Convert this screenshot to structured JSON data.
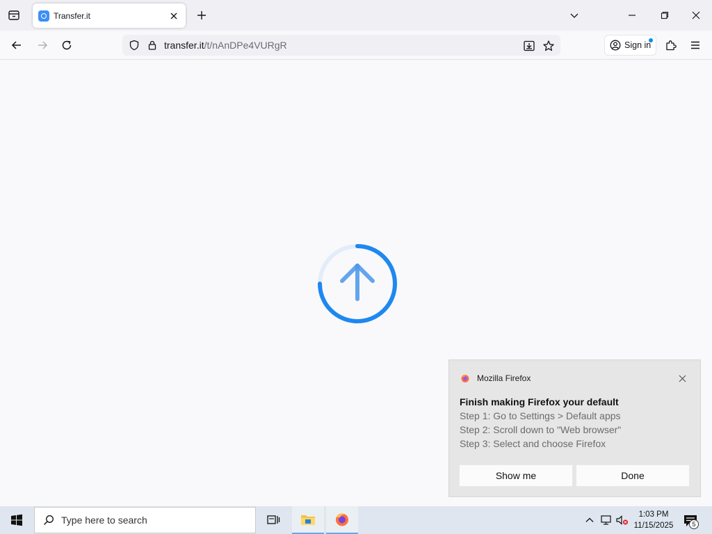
{
  "browser": {
    "tab": {
      "title": "Transfer.it"
    },
    "url": {
      "domain": "transfer.it",
      "path": "/t/nAnDPe4VURgR"
    },
    "signin_label": "Sign in"
  },
  "notification": {
    "app_name": "Mozilla Firefox",
    "title": "Finish making Firefox your default",
    "steps": [
      "Step 1: Go to Settings > Default apps",
      "Step 2: Scroll down to \"Web browser\"",
      "Step 3: Select and choose Firefox"
    ],
    "buttons": {
      "primary": "Show me",
      "secondary": "Done"
    }
  },
  "taskbar": {
    "search_placeholder": "Type here to search",
    "time": "1:03 PM",
    "date": "11/15/2025",
    "notification_count": "5"
  },
  "colors": {
    "spinner_accent": "#1e88f0",
    "spinner_track": "#e3edf9",
    "arrow": "#4a97ea"
  },
  "icons": {
    "tab_list": "tab-list-icon",
    "favicon": "transfer-favicon",
    "back": "arrow-left-icon",
    "forward": "arrow-right-icon",
    "reload": "reload-icon",
    "shield": "shield-icon",
    "lock": "lock-icon",
    "download": "download-icon",
    "bookmark": "star-icon",
    "account": "account-icon",
    "extensions": "puzzle-icon",
    "menu": "hamburger-icon",
    "upload_spinner": "upload-arrow-icon"
  }
}
